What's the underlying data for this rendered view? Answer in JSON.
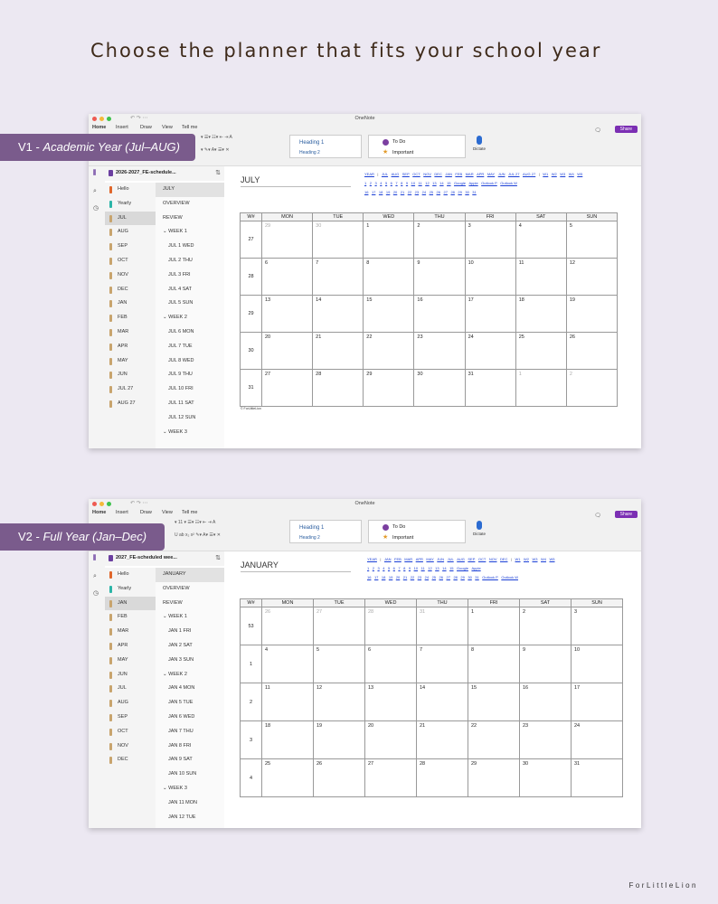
{
  "headline": "Choose the planner that fits your school year",
  "brand": "ForLittleLion",
  "badges": {
    "v1_prefix": "V1 - ",
    "v1_label": "Academic Year (Jul–AUG)",
    "v2_prefix": "V2 - ",
    "v2_label": "Full Year (Jan–Dec)"
  },
  "app": {
    "title": "OneNote",
    "menus": [
      "Home",
      "Insert",
      "Draw",
      "View",
      "Tell me"
    ],
    "styles": [
      "Heading 1",
      "Heading 2"
    ],
    "tags": [
      "To Do",
      "Important"
    ],
    "dictate": "Dictate",
    "share": "Share",
    "font_size": "11"
  },
  "win1": {
    "notebook": "2026-2027_FE-schedule...",
    "sections": [
      {
        "label": "Hello",
        "color": "#e0662b"
      },
      {
        "label": "Yearly",
        "color": "#2bb5a7"
      },
      {
        "label": "JUL",
        "color": "#c8a46d"
      },
      {
        "label": "AUG",
        "color": "#c8a46d"
      },
      {
        "label": "SEP",
        "color": "#c8a46d"
      },
      {
        "label": "OCT",
        "color": "#c8a46d"
      },
      {
        "label": "NOV",
        "color": "#c8a46d"
      },
      {
        "label": "DEC",
        "color": "#c8a46d"
      },
      {
        "label": "JAN",
        "color": "#c8a46d"
      },
      {
        "label": "FEB",
        "color": "#c8a46d"
      },
      {
        "label": "MAR",
        "color": "#c8a46d"
      },
      {
        "label": "APR",
        "color": "#c8a46d"
      },
      {
        "label": "MAY",
        "color": "#c8a46d"
      },
      {
        "label": "JUN",
        "color": "#c8a46d"
      },
      {
        "label": "JUL 27",
        "color": "#c8a46d"
      },
      {
        "label": "AUG 27",
        "color": "#c8a46d"
      }
    ],
    "pages": [
      "JULY",
      "OVERVIEW",
      "REVIEW",
      "⌄ WEEK 1",
      "JUL 1  WED",
      "JUL 2  THU",
      "JUL 3  FRI",
      "JUL 4  SAT",
      "JUL 5  SUN",
      "⌄ WEEK 2",
      "JUL 6  MON",
      "JUL 7  TUE",
      "JUL 8  WED",
      "JUL 9  THU",
      "JUL 10  FRI",
      "JUL 11  SAT",
      "JUL 12  SUN",
      "⌄ WEEK 3"
    ],
    "page_title": "JULY",
    "nav_row1": [
      "YEAR",
      "|",
      "JUL",
      "AUG",
      "SEP",
      "OCT",
      "NOV",
      "DEC",
      "JAN",
      "FEB",
      "MAR",
      "APR",
      "MAY",
      "JUN",
      "JUL 27",
      "AUG 27",
      "|",
      "W1",
      "W2",
      "W3",
      "W4",
      "W5"
    ],
    "nav_row2": [
      "1",
      "2",
      "3",
      "4",
      "5",
      "6",
      "7",
      "8",
      "9",
      "10",
      "11",
      "12",
      "13",
      "14",
      "15",
      "Google",
      "Apple",
      "Outlook P",
      "Outlook W"
    ],
    "nav_row3": [
      "16",
      "17",
      "18",
      "19",
      "20",
      "21",
      "22",
      "23",
      "24",
      "25",
      "26",
      "27",
      "28",
      "29",
      "30",
      "31"
    ],
    "headers": [
      "W#",
      "MON",
      "TUE",
      "WED",
      "THU",
      "FRI",
      "SAT",
      "SUN"
    ],
    "rows": [
      {
        "wk": "27",
        "days": [
          "29",
          "30",
          "1",
          "2",
          "3",
          "4",
          "5"
        ],
        "dim": [
          0,
          1
        ]
      },
      {
        "wk": "28",
        "days": [
          "6",
          "7",
          "8",
          "9",
          "10",
          "11",
          "12"
        ],
        "dim": []
      },
      {
        "wk": "29",
        "days": [
          "13",
          "14",
          "15",
          "16",
          "17",
          "18",
          "19"
        ],
        "dim": []
      },
      {
        "wk": "30",
        "days": [
          "20",
          "21",
          "22",
          "23",
          "24",
          "25",
          "26"
        ],
        "dim": []
      },
      {
        "wk": "31",
        "days": [
          "27",
          "28",
          "29",
          "30",
          "31",
          "1",
          "2"
        ],
        "dim": [
          5,
          6
        ]
      }
    ],
    "footnote": "© ForLittleLion"
  },
  "win2": {
    "notebook": "2027_FE-scheduled wee...",
    "sections": [
      {
        "label": "Hello",
        "color": "#e0662b"
      },
      {
        "label": "Yearly",
        "color": "#2bb5a7"
      },
      {
        "label": "JAN",
        "color": "#c8a46d"
      },
      {
        "label": "FEB",
        "color": "#c8a46d"
      },
      {
        "label": "MAR",
        "color": "#c8a46d"
      },
      {
        "label": "APR",
        "color": "#c8a46d"
      },
      {
        "label": "MAY",
        "color": "#c8a46d"
      },
      {
        "label": "JUN",
        "color": "#c8a46d"
      },
      {
        "label": "JUL",
        "color": "#c8a46d"
      },
      {
        "label": "AUG",
        "color": "#c8a46d"
      },
      {
        "label": "SEP",
        "color": "#c8a46d"
      },
      {
        "label": "OCT",
        "color": "#c8a46d"
      },
      {
        "label": "NOV",
        "color": "#c8a46d"
      },
      {
        "label": "DEC",
        "color": "#c8a46d"
      }
    ],
    "pages": [
      "JANUARY",
      "OVERVIEW",
      "REVIEW",
      "⌄ WEEK 1",
      "JAN 1  FRI",
      "JAN 2  SAT",
      "JAN 3  SUN",
      "⌄ WEEK 2",
      "JAN 4  MON",
      "JAN 5  TUE",
      "JAN 6  WED",
      "JAN 7  THU",
      "JAN 8  FRI",
      "JAN 9  SAT",
      "JAN 10  SUN",
      "⌄ WEEK 3",
      "JAN 11  MON",
      "JAN 12  TUE"
    ],
    "page_title": "JANUARY",
    "nav_row1": [
      "YEAR",
      "|",
      "JAN",
      "FEB",
      "MAR",
      "APR",
      "MAY",
      "JUN",
      "JUL",
      "AUG",
      "SEP",
      "OCT",
      "NOV",
      "DEC",
      "|",
      "W1",
      "W2",
      "W3",
      "W4",
      "W5"
    ],
    "nav_row2": [
      "1",
      "2",
      "3",
      "4",
      "5",
      "6",
      "7",
      "8",
      "9",
      "10",
      "11",
      "12",
      "13",
      "14",
      "15",
      "Google",
      "Apple"
    ],
    "nav_row3": [
      "16",
      "17",
      "18",
      "19",
      "20",
      "21",
      "22",
      "23",
      "24",
      "25",
      "26",
      "27",
      "28",
      "29",
      "30",
      "31",
      "Outlook P",
      "Outlook W"
    ],
    "headers": [
      "W#",
      "MON",
      "TUE",
      "WED",
      "THU",
      "FRI",
      "SAT",
      "SUN"
    ],
    "rows": [
      {
        "wk": "53",
        "days": [
          "26",
          "27",
          "28",
          "31",
          "1",
          "2",
          "3"
        ],
        "dim": [
          0,
          1,
          2,
          3
        ]
      },
      {
        "wk": "1",
        "days": [
          "4",
          "5",
          "6",
          "7",
          "8",
          "9",
          "10"
        ],
        "dim": []
      },
      {
        "wk": "2",
        "days": [
          "11",
          "12",
          "13",
          "14",
          "15",
          "16",
          "17"
        ],
        "dim": []
      },
      {
        "wk": "3",
        "days": [
          "18",
          "19",
          "20",
          "21",
          "22",
          "23",
          "24"
        ],
        "dim": []
      },
      {
        "wk": "4",
        "days": [
          "25",
          "26",
          "27",
          "28",
          "29",
          "30",
          "31"
        ],
        "dim": []
      }
    ]
  }
}
